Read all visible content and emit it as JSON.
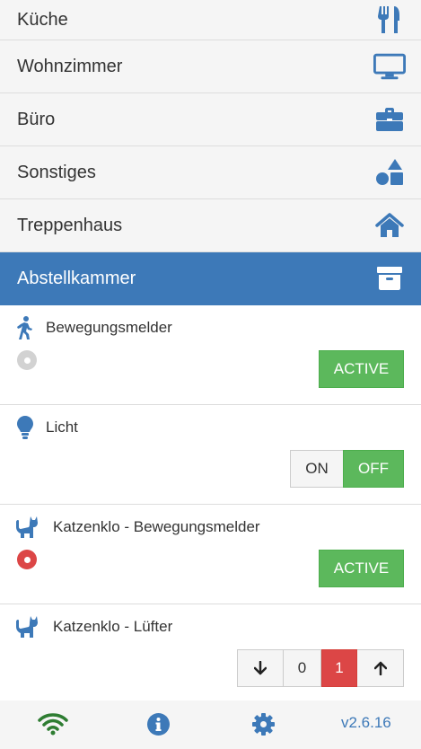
{
  "rooms": [
    {
      "label": "Küche",
      "icon": "utensils-icon"
    },
    {
      "label": "Wohnzimmer",
      "icon": "monitor-icon"
    },
    {
      "label": "Büro",
      "icon": "briefcase-icon"
    },
    {
      "label": "Sonstiges",
      "icon": "shapes-icon"
    },
    {
      "label": "Treppenhaus",
      "icon": "home-icon"
    },
    {
      "label": "Abstellkammer",
      "icon": "archive-icon",
      "active": true
    }
  ],
  "devices": [
    {
      "name": "Bewegungsmelder",
      "icon": "walking-person-icon",
      "state": "inactive",
      "button": "ACTIVE"
    },
    {
      "name": "Licht",
      "icon": "lightbulb-icon",
      "toggle": {
        "on": "ON",
        "off": "OFF",
        "selected": "OFF"
      }
    },
    {
      "name": "Katzenklo - Bewegungsmelder",
      "icon": "cat-icon",
      "state": "triggered",
      "button": "ACTIVE"
    },
    {
      "name": "Katzenklo - Lüfter",
      "icon": "cat-icon",
      "stepper": {
        "values": [
          "0",
          "1"
        ],
        "selected": "1"
      }
    }
  ],
  "footer": {
    "icons": [
      "wifi-icon",
      "info-icon",
      "gear-icon"
    ],
    "version": "v2.6.16"
  },
  "colors": {
    "accent": "#3d79b8",
    "success": "#5cb85c",
    "danger": "#dc4646",
    "wifi": "#2e7d32"
  }
}
